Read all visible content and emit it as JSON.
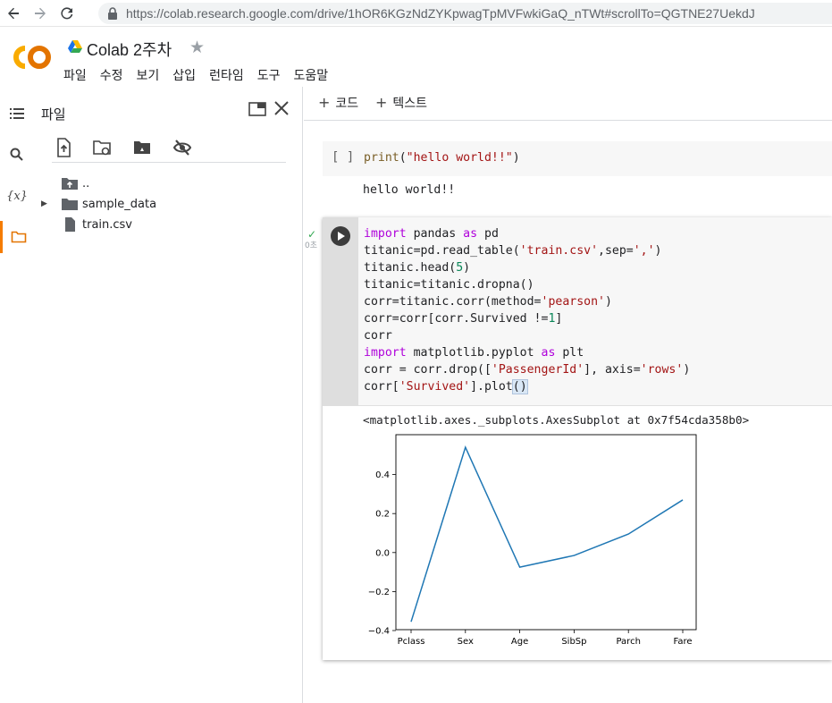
{
  "browser": {
    "url": "https://colab.research.google.com/drive/1hOR6KGzNdZYKpwagTpMVFwkiGaQ_nTWt#scrollTo=QGTNE27UekdJ"
  },
  "header": {
    "logo_text": "CO",
    "title": "Colab 2주차",
    "menu": [
      "파일",
      "수정",
      "보기",
      "삽입",
      "런타임",
      "도구",
      "도움말"
    ]
  },
  "files_panel": {
    "title": "파일",
    "tree": [
      {
        "name": "..",
        "type": "parent"
      },
      {
        "name": "sample_data",
        "type": "folder"
      },
      {
        "name": "train.csv",
        "type": "file"
      }
    ]
  },
  "toolbar": {
    "add_code": "코드",
    "add_text": "텍스트"
  },
  "cell1": {
    "bracket": "[ ]",
    "code": "print(\"hello world!!\")",
    "output": "hello world!!"
  },
  "cell2": {
    "status_time": "0초",
    "output_text": "<matplotlib.axes._subplots.AxesSubplot at 0x7f54cda358b0>"
  },
  "chart_data": {
    "type": "line",
    "categories": [
      "Pclass",
      "Sex",
      "Age",
      "SibSp",
      "Parch",
      "Fare"
    ],
    "series": [
      {
        "values": [
          -0.355,
          0.54,
          -0.075,
          -0.015,
          0.095,
          0.27
        ],
        "color": "#1f77b4"
      }
    ],
    "yticks": [
      "0.4",
      "0.2",
      "0.0",
      "−0.2",
      "−0.4"
    ],
    "ytick_values": [
      0.4,
      0.2,
      0.0,
      -0.2,
      -0.4
    ],
    "ylim": [
      -0.4,
      0.6
    ],
    "grid": false
  }
}
